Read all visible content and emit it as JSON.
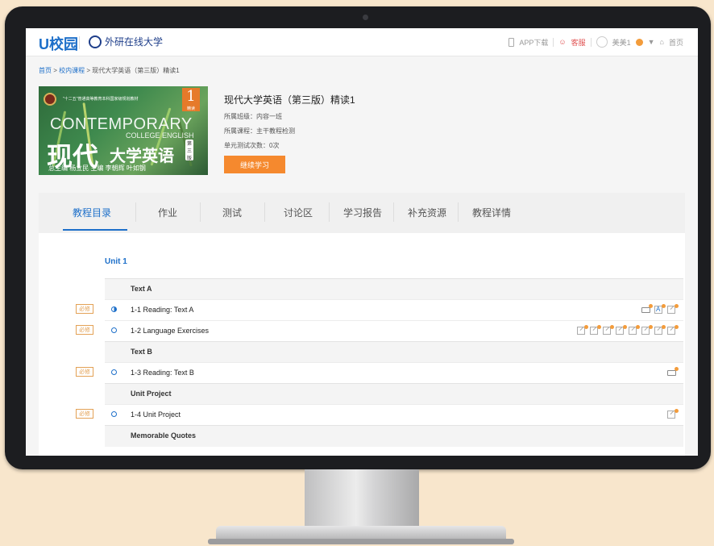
{
  "header": {
    "logo": "U校园",
    "school": "外研在线大学",
    "app_download": "APP下载",
    "kefu": "客服",
    "user": "美美1",
    "home": "首页"
  },
  "breadcrumb": {
    "home": "首页",
    "courses": "校内课程",
    "current": "现代大学英语（第三版）精读1"
  },
  "cover": {
    "series": "\"十二五\"普通高等教育本科国家级规划教材",
    "number": "1",
    "volume": "精读",
    "en_title": "CONTEMPORARY",
    "en_sub": "COLLEGE ENGLISH",
    "cn_title": "现代",
    "cn_title2": "大学英语",
    "tag": "第三版",
    "authors": "总主编  杨立民   主编  李朝辉  叶如钢"
  },
  "course": {
    "title": "现代大学英语（第三版）精读1",
    "class": "所属班级：内容一班",
    "program": "所属课程：主干教程检测",
    "tests": "单元测试次数：0次",
    "continue_label": "继续学习"
  },
  "tabs": [
    "教程目录",
    "作业",
    "测试",
    "讨论区",
    "学习报告",
    "补充资源",
    "教程详情"
  ],
  "unit": {
    "title": "Unit 1",
    "required_label": "必修",
    "rows": [
      {
        "kind": "section",
        "title": "Text A"
      },
      {
        "kind": "item",
        "title": "1-1 Reading: Text A",
        "required": true,
        "status": "half",
        "icons": [
          "chat-icon",
          "a-icon",
          "edit-icon"
        ]
      },
      {
        "kind": "item",
        "title": "1-2 Language Exercises",
        "required": true,
        "status": "empty",
        "icons": [
          "edit-icon",
          "edit-icon",
          "edit-icon",
          "edit-icon",
          "edit-icon",
          "edit-icon",
          "edit-icon",
          "edit-icon"
        ]
      },
      {
        "kind": "section",
        "title": "Text B"
      },
      {
        "kind": "item",
        "title": "1-3 Reading: Text B",
        "required": true,
        "status": "empty",
        "icons": [
          "chat-icon"
        ]
      },
      {
        "kind": "section",
        "title": "Unit Project"
      },
      {
        "kind": "item",
        "title": "1-4 Unit Project",
        "required": true,
        "status": "empty",
        "icons": [
          "edit-icon"
        ]
      },
      {
        "kind": "section",
        "title": "Memorable Quotes"
      }
    ]
  },
  "colors": {
    "accent": "#1d6fc9",
    "button": "#f5892e",
    "required": "#e3a155",
    "background": "#f8e6cc"
  }
}
